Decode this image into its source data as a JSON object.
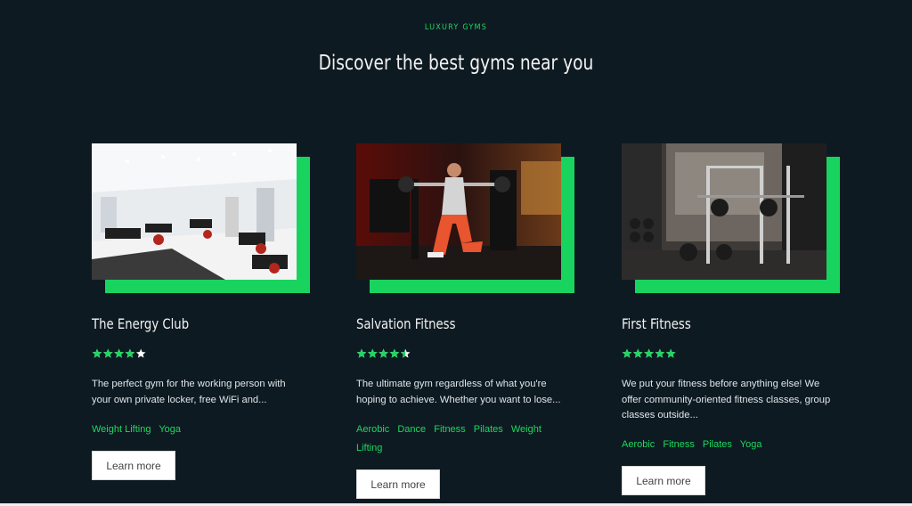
{
  "section": {
    "eyebrow": "LUXURY GYMS",
    "headline": "Discover the best gyms near you"
  },
  "colors": {
    "accent": "#19d35f",
    "background": "#0e1a22",
    "star": "#1ed760"
  },
  "gyms": [
    {
      "name": "The Energy Club",
      "rating": 4,
      "description": "The perfect gym for the working person with your own private locker, free WiFi and...",
      "tags": [
        "Weight Lifting",
        "Yoga"
      ],
      "button": "Learn more",
      "image_icon": "gym-interior-photo"
    },
    {
      "name": "Salvation Fitness",
      "rating": 4.5,
      "description": "The ultimate gym regardless of what you're hoping to achieve. Whether you want to lose...",
      "tags": [
        "Aerobic",
        "Dance",
        "Fitness",
        "Pilates",
        "Weight Lifting"
      ],
      "button": "Learn more",
      "image_icon": "woman-squat-photo"
    },
    {
      "name": "First Fitness",
      "rating": 5,
      "description": "We put your fitness before anything else! We offer community-oriented fitness classes, group classes outside...",
      "tags": [
        "Aerobic",
        "Fitness",
        "Pilates",
        "Yoga"
      ],
      "button": "Learn more",
      "image_icon": "squat-rack-photo"
    }
  ]
}
